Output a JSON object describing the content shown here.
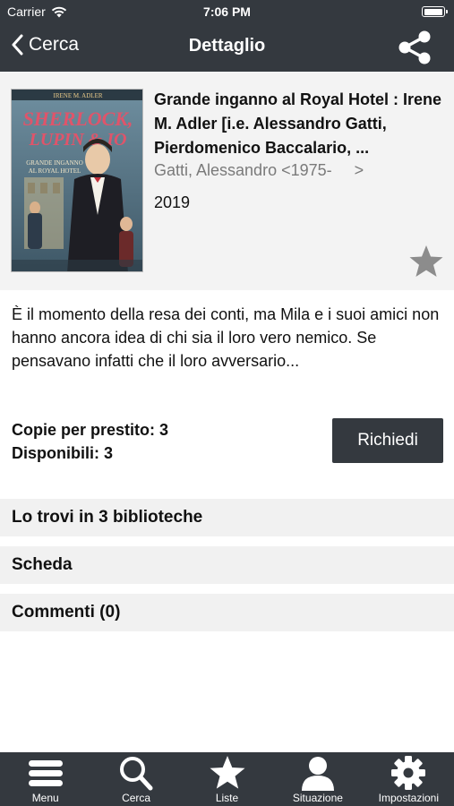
{
  "status_bar": {
    "carrier": "Carrier",
    "time": "7:06 PM",
    "battery_level": 1.0
  },
  "nav": {
    "back_label": "Cerca",
    "title": "Dettaglio",
    "share_icon": "share-icon"
  },
  "book": {
    "title": "Grande inganno al Royal Hotel : Irene M. Adler [i.e. Alessandro Gatti, Pierdomenico Baccalario, ...",
    "author": "Gatti, Alessandro <1975-",
    "author_chevron": ">",
    "year": "2019",
    "cover": {
      "series_author": "IRENE M. ADLER",
      "series_title_line1": "SHERLOCK,",
      "series_title_line2": "LUPIN & IO",
      "cover_title_line1": "GRANDE INGANNO",
      "cover_title_line2": "AL ROYAL HOTEL"
    }
  },
  "description": "È il momento della resa dei conti, ma Mila e i suoi amici non hanno ancora idea di chi sia il loro vero nemico. Se pensavano infatti che il loro avversario...",
  "copies": {
    "loan_label": "Copie per prestito: 3",
    "available_label": "Disponibili: 3"
  },
  "request_button": "Richiedi",
  "sections": [
    {
      "label": "Lo trovi in 3 biblioteche"
    },
    {
      "label": "Scheda"
    },
    {
      "label": "Commenti (0)"
    }
  ],
  "tabs": [
    {
      "label": "Menu",
      "icon": "menu-icon"
    },
    {
      "label": "Cerca",
      "icon": "search-icon"
    },
    {
      "label": "Liste",
      "icon": "star-icon"
    },
    {
      "label": "Situazione",
      "icon": "user-icon"
    },
    {
      "label": "Impostazioni",
      "icon": "gear-icon"
    }
  ],
  "colors": {
    "bar": "#34393f",
    "header_bg": "#f3f3f3",
    "section_bg": "#f1f1f1",
    "muted_text": "#7a7a7a",
    "star": "#8c8c8c"
  }
}
